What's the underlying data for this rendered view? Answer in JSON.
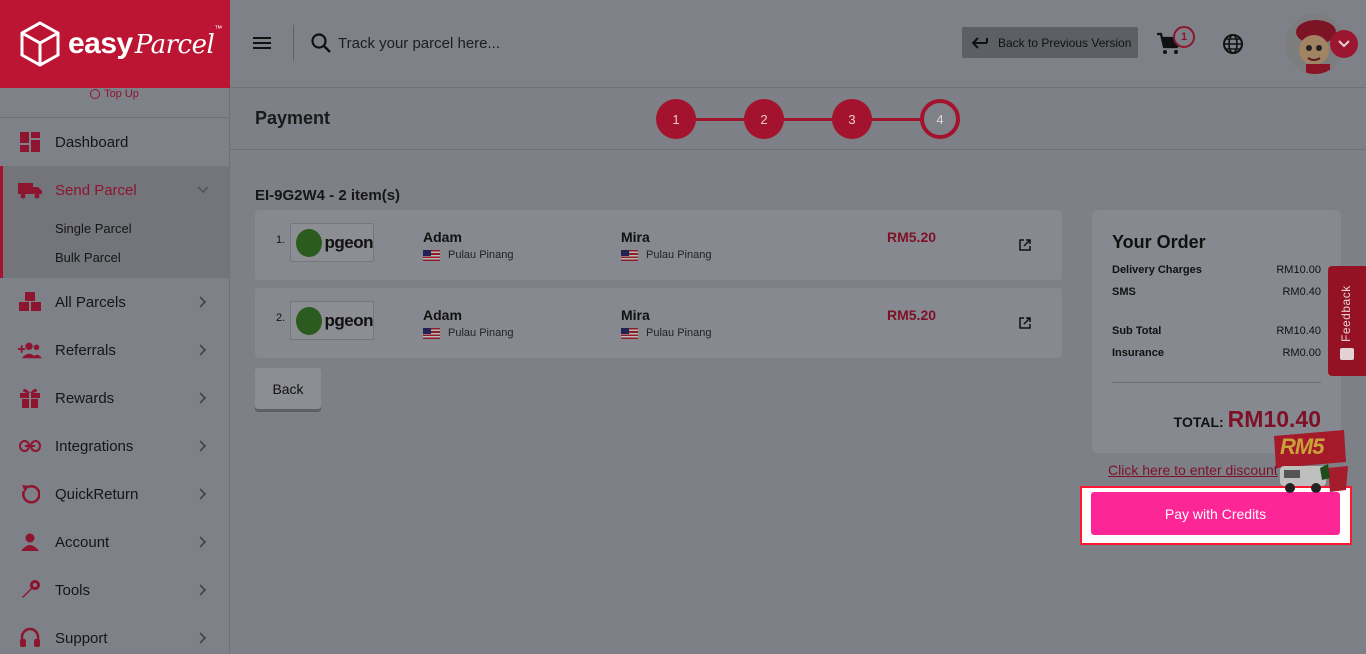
{
  "brand": {
    "name": "easy",
    "name_script": "Parcel",
    "tm": "™"
  },
  "header": {
    "search_placeholder": "Track your parcel here...",
    "back_version_label": "Back to Previous Version",
    "cart_count": "1"
  },
  "sidebar": {
    "topup_label": "Top Up",
    "items": [
      {
        "label": "Dashboard",
        "icon": "dashboard-icon"
      },
      {
        "label": "Send Parcel",
        "icon": "truck-icon",
        "expanded": true,
        "children": [
          "Single Parcel",
          "Bulk Parcel"
        ]
      },
      {
        "label": "All Parcels",
        "icon": "boxes-icon"
      },
      {
        "label": "Referrals",
        "icon": "users-add-icon"
      },
      {
        "label": "Rewards",
        "icon": "gift-icon"
      },
      {
        "label": "Integrations",
        "icon": "link-icon"
      },
      {
        "label": "QuickReturn",
        "icon": "return-icon"
      },
      {
        "label": "Account",
        "icon": "person-icon"
      },
      {
        "label": "Tools",
        "icon": "wrench-icon"
      },
      {
        "label": "Support",
        "icon": "headset-icon"
      }
    ]
  },
  "page": {
    "title": "Payment",
    "steps": [
      "1",
      "2",
      "3",
      "4"
    ],
    "current_step": 4,
    "order_id": "EI-9G2W4 - 2 item(s)"
  },
  "parcels": [
    {
      "num": "1.",
      "courier": "pgeon",
      "sender": "Adam",
      "sender_loc": "Pulau Pinang",
      "receiver": "Mira",
      "receiver_loc": "Pulau Pinang",
      "price": "RM5.20"
    },
    {
      "num": "2.",
      "courier": "pgeon",
      "sender": "Adam",
      "sender_loc": "Pulau Pinang",
      "receiver": "Mira",
      "receiver_loc": "Pulau Pinang",
      "price": "RM5.20"
    }
  ],
  "back_label": "Back",
  "order_summary": {
    "title": "Your Order",
    "lines": [
      {
        "label": "Delivery Charges",
        "value": "RM10.00"
      },
      {
        "label": "SMS",
        "value": "RM0.40"
      },
      {
        "label": "Sub Total",
        "value": "RM10.40"
      },
      {
        "label": "Insurance",
        "value": "RM0.00"
      }
    ],
    "total_label": "TOTAL:",
    "total_value": "RM10.40"
  },
  "discount_link": "Click here to enter discount",
  "pay_button": "Pay with Credits",
  "promo_badge": "RM5",
  "feedback_label": "Feedback",
  "colors": {
    "brand": "#bc1533",
    "pay_button": "#fc2697",
    "price": "#7e1128"
  }
}
